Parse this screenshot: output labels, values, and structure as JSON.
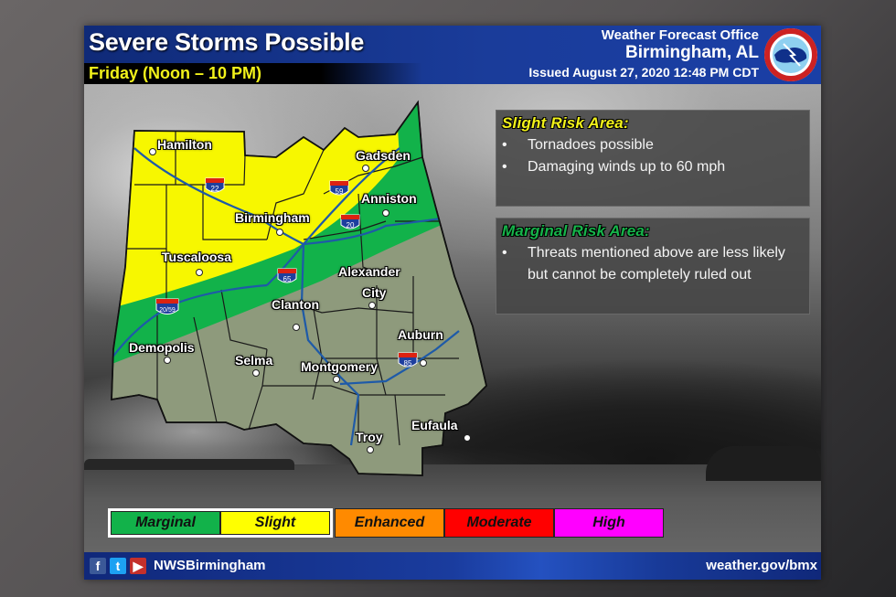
{
  "header": {
    "title": "Severe Storms Possible",
    "subtitle": "Friday (Noon – 10 PM)",
    "office_line1": "Weather Forecast Office",
    "office_line2": "Birmingham, AL",
    "issued": "Issued August 27, 2020 12:48 PM CDT",
    "logo_icon": "nws-logo-icon"
  },
  "map": {
    "cities": [
      {
        "name": "Hamilton"
      },
      {
        "name": "Gadsden"
      },
      {
        "name": "Anniston"
      },
      {
        "name": "Birmingham"
      },
      {
        "name": "Tuscaloosa"
      },
      {
        "name": "Alexander"
      },
      {
        "name": "City"
      },
      {
        "name": "Clanton"
      },
      {
        "name": "Demopolis"
      },
      {
        "name": "Selma"
      },
      {
        "name": "Montgomery"
      },
      {
        "name": "Auburn"
      },
      {
        "name": "Eufaula"
      },
      {
        "name": "Troy"
      }
    ],
    "interstates": [
      "22",
      "59",
      "20",
      "65",
      "20/59",
      "85"
    ],
    "risk_colors": {
      "marginal": "#12b24a",
      "slight": "#f7f700",
      "none": "#8e9a7c"
    }
  },
  "info": {
    "slight": {
      "title": "Slight Risk Area:",
      "color": "#f2f21a",
      "bullets": [
        "Tornadoes possible",
        "Damaging winds up to 60 mph"
      ]
    },
    "marginal": {
      "title": "Marginal Risk Area:",
      "color": "#16b44a",
      "bullets": [
        "Threats mentioned above are less likely but cannot be completely ruled out"
      ]
    }
  },
  "legend": [
    {
      "label": "Marginal",
      "color": "#12b24a"
    },
    {
      "label": "Slight",
      "color": "#ffff00"
    },
    {
      "label": "Enhanced",
      "color": "#ff8a00"
    },
    {
      "label": "Moderate",
      "color": "#ff0000"
    },
    {
      "label": "High",
      "color": "#ff00ff"
    }
  ],
  "footer": {
    "facebook": "f",
    "twitter": "t",
    "youtube": "▶",
    "handle": "NWSBirmingham",
    "website": "weather.gov/bmx"
  }
}
